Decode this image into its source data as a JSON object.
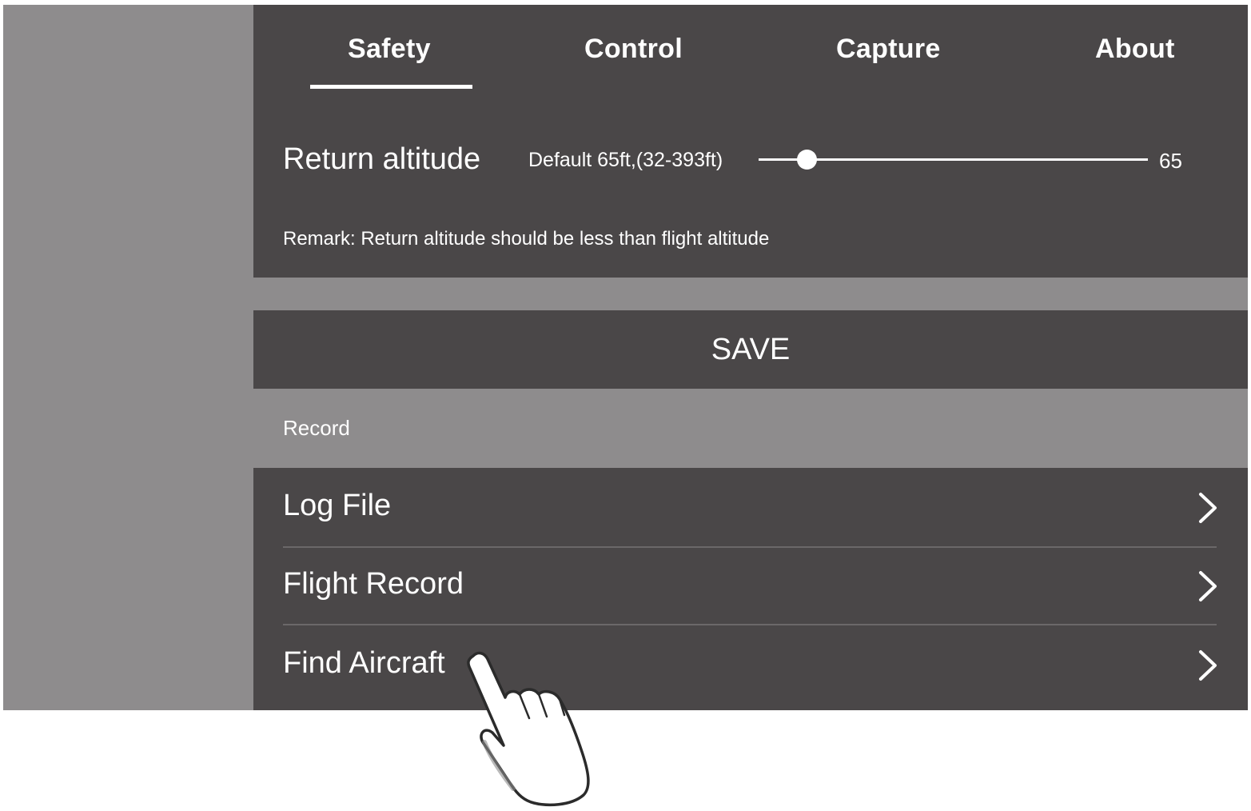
{
  "tabs": [
    {
      "label": "Safety",
      "active": true
    },
    {
      "label": "Control",
      "active": false
    },
    {
      "label": "Capture",
      "active": false
    },
    {
      "label": "About",
      "active": false
    }
  ],
  "return_altitude": {
    "label": "Return altitude",
    "hint": "Default 65ft,(32-393ft)",
    "value": "65",
    "min": 32,
    "max": 393,
    "remark": "Remark: Return altitude should be less than flight altitude"
  },
  "save_label": "SAVE",
  "record": {
    "header": "Record",
    "items": [
      {
        "label": "Log File"
      },
      {
        "label": "Flight Record"
      },
      {
        "label": "Find Aircraft"
      }
    ]
  },
  "icons": {
    "chevron": "chevron-right-icon",
    "hand": "pointing-hand-icon"
  },
  "colors": {
    "panel_dark": "#4a4748",
    "panel_gray": "#8e8c8d",
    "text": "#ffffff"
  }
}
